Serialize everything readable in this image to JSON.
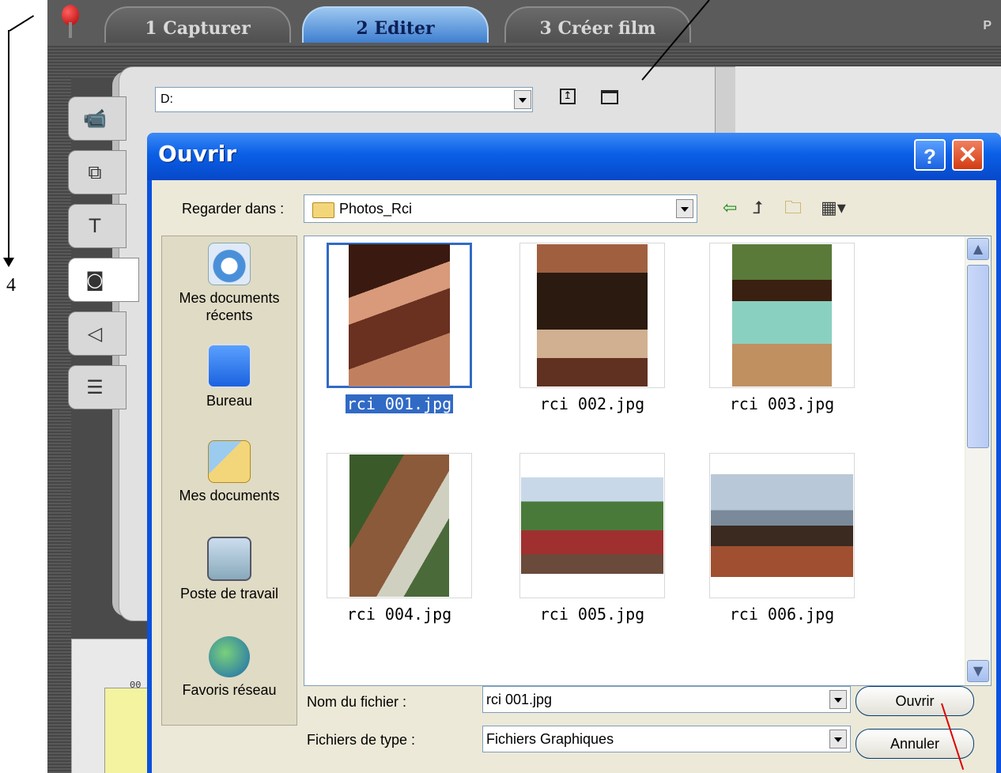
{
  "app": {
    "tabs": [
      {
        "label": "1 Capturer"
      },
      {
        "label": "2 Editer"
      },
      {
        "label": "3 Créer film"
      }
    ],
    "corner_letter": "P",
    "path_value": "D:",
    "timeline_label": "00"
  },
  "annotation": {
    "number": "4"
  },
  "dialog": {
    "title": "Ouvrir",
    "help_label": "?",
    "close_label": "✕",
    "look_in_label": "Regarder dans :",
    "look_in_value": "Photos_Rci",
    "toolbar_icons": [
      "back-arrow-icon",
      "folder-up-icon",
      "new-folder-icon",
      "view-menu-icon"
    ],
    "places": [
      {
        "label_line1": "Mes documents",
        "label_line2": "récents",
        "icon": "recent-documents-icon"
      },
      {
        "label_line1": "Bureau",
        "label_line2": "",
        "icon": "desktop-icon"
      },
      {
        "label_line1": "Mes documents",
        "label_line2": "",
        "icon": "my-documents-icon"
      },
      {
        "label_line1": "Poste de travail",
        "label_line2": "",
        "icon": "my-computer-icon"
      },
      {
        "label_line1": "Favoris réseau",
        "label_line2": "",
        "icon": "network-places-icon"
      }
    ],
    "files": [
      {
        "name": "rci 001.jpg",
        "selected": true
      },
      {
        "name": "rci 002.jpg",
        "selected": false
      },
      {
        "name": "rci 003.jpg",
        "selected": false
      },
      {
        "name": "rci 004.jpg",
        "selected": false
      },
      {
        "name": "rci 005.jpg",
        "selected": false
      },
      {
        "name": "rci 006.jpg",
        "selected": false
      }
    ],
    "filename_label": "Nom du fichier :",
    "filename_value": "rci 001.jpg",
    "filetype_label": "Fichiers de type :",
    "filetype_value": "Fichiers Graphiques",
    "open_button": "Ouvrir",
    "cancel_button": "Annuler"
  }
}
